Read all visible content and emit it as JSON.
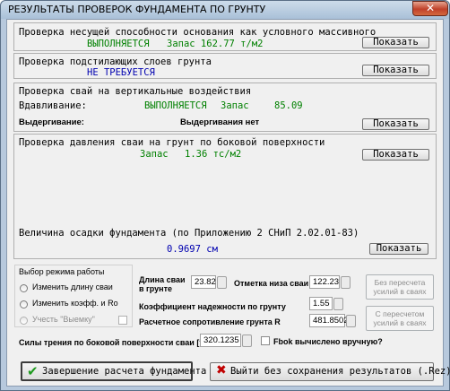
{
  "window": {
    "title": "РЕЗУЛЬТАТЫ ПРОВЕРОК ФУНДАМЕНТА ПО ГРУНТУ",
    "close_symbol": "✕"
  },
  "checks": {
    "bearing": {
      "title": "Проверка несущей способности основания как условного массивного",
      "status": "ВЫПОЛНЯЕТСЯ",
      "margin": "Запас 162.77 т/м2",
      "show_label": "Показать"
    },
    "underlying": {
      "title": "Проверка подстилающих слоев грунта",
      "status": "НЕ ТРЕБУЕТСЯ",
      "show_label": "Показать"
    },
    "piles_vertical": {
      "title": "Проверка свай на вертикальные воздействия",
      "push_label": "Вдавливание:",
      "push_status": "ВЫПОЛНЯЕТСЯ",
      "push_margin_label": "Запас",
      "push_margin_value": "85.09",
      "pull_label": "Выдергивание:",
      "pull_status": "Выдергивания нет",
      "show_label": "Показать"
    },
    "lateral": {
      "title": "Проверка давления сваи на грунт по боковой поверхности",
      "margin_label": "Запас",
      "margin_value": "1.36 тс/м2",
      "show_label": "Показать"
    },
    "settlement": {
      "title": "Величина осадки фундамента (по Приложению 2 СНиП 2.02.01-83)",
      "value": "0.9697 см",
      "show_label": "Показать"
    }
  },
  "mode": {
    "group_label": "Выбор режима работы",
    "options": [
      "Изменить длину сваи",
      "Изменить коэфф. и Ro",
      "Учесть \"Выемку\""
    ]
  },
  "params": {
    "pile_length_label_1": "Длина сваи",
    "pile_length_label_2": "в грунте",
    "pile_length": "23.82",
    "pile_bottom_label": "Отметка низа сваи",
    "pile_bottom": "122.23",
    "reliability_label": "Коэффициент надежности по грунту",
    "reliability": "1.55",
    "resistance_label": "Расчетное сопротивление грунта R",
    "resistance": "481.8502",
    "friction_label": "Силы трения по боковой поверхности сваи [т]",
    "friction": "320.1235",
    "fbok_label": "Fbok вычислено вручную?",
    "no_recalc_label": "Без пересчета усилий в сваях",
    "recalc_label": "С пересчетом усилий в сваях"
  },
  "footer": {
    "finish_label": "Завершение расчета фундамента",
    "exit_label": "Выйти без сохранения результатов (.Rez)"
  },
  "colors": {
    "ok_green": "#008000",
    "info_blue": "#0000b0",
    "check_icon": "#1e9a1e",
    "cross_icon": "#c00000"
  }
}
